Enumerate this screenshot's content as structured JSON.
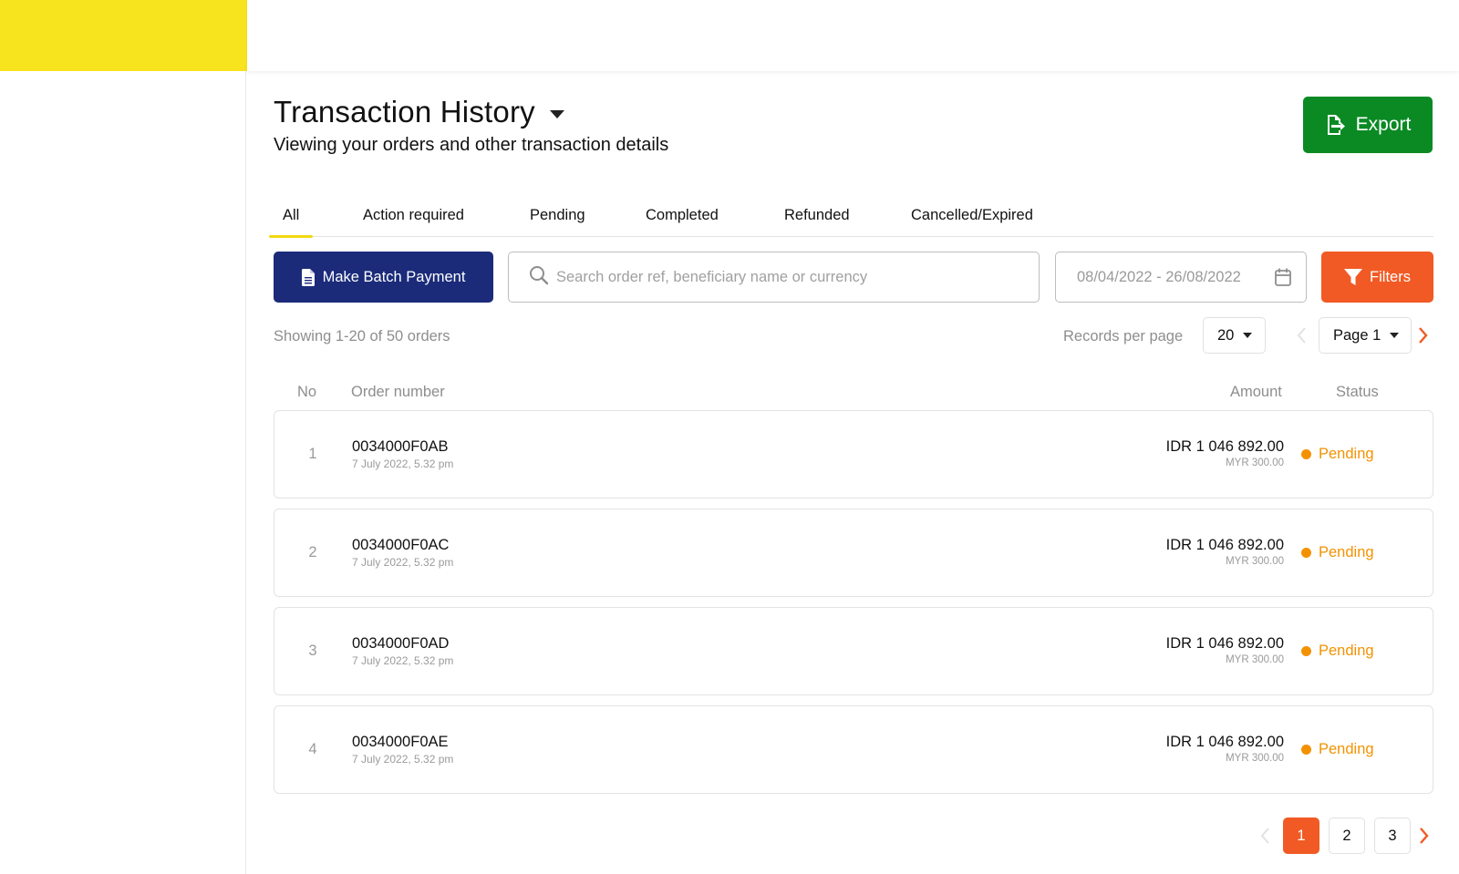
{
  "header": {
    "title": "Transaction History",
    "subtitle": "Viewing your orders and other transaction details",
    "export_label": "Export"
  },
  "tabs": [
    {
      "label": "All",
      "active": true
    },
    {
      "label": "Action required",
      "active": false
    },
    {
      "label": "Pending",
      "active": false
    },
    {
      "label": "Completed",
      "active": false
    },
    {
      "label": "Refunded",
      "active": false
    },
    {
      "label": "Cancelled/Expired",
      "active": false
    }
  ],
  "toolbar": {
    "batch_payment_label": "Make Batch Payment",
    "search_placeholder": "Search order ref, beneficiary name or currency",
    "date_range": "08/04/2022 - 26/08/2022",
    "filters_label": "Filters"
  },
  "listing": {
    "showing_text": "Showing 1-20 of 50 orders",
    "records_per_page_label": "Records per page",
    "records_per_page_value": "20",
    "page_select_value": "Page 1"
  },
  "table": {
    "headers": {
      "no": "No",
      "order_number": "Order number",
      "amount": "Amount",
      "status": "Status"
    },
    "rows": [
      {
        "no": "1",
        "order_number": "0034000F0AB",
        "date": "7 July 2022, 5.32 pm",
        "amount": "IDR 1 046 892.00",
        "amount_secondary": "MYR 300.00",
        "status": "Pending"
      },
      {
        "no": "2",
        "order_number": "0034000F0AC",
        "date": "7 July 2022, 5.32 pm",
        "amount": "IDR 1 046 892.00",
        "amount_secondary": "MYR 300.00",
        "status": "Pending"
      },
      {
        "no": "3",
        "order_number": "0034000F0AD",
        "date": "7 July 2022, 5.32 pm",
        "amount": "IDR 1 046 892.00",
        "amount_secondary": "MYR 300.00",
        "status": "Pending"
      },
      {
        "no": "4",
        "order_number": "0034000F0AE",
        "date": "7 July 2022, 5.32 pm",
        "amount": "IDR 1 046 892.00",
        "amount_secondary": "MYR 300.00",
        "status": "Pending"
      }
    ]
  },
  "pagination": {
    "pages": [
      "1",
      "2",
      "3"
    ],
    "current": "1"
  },
  "colors": {
    "brand_yellow": "#f7e31e",
    "export_green": "#0b8a24",
    "batch_navy": "#1b2b7a",
    "accent_orange": "#f15a24",
    "pending_orange": "#f39200"
  },
  "icons": {
    "export": "file-export-icon",
    "batch": "document-icon",
    "search": "search-icon",
    "calendar": "calendar-icon",
    "filters": "funnel-icon",
    "prev": "chevron-left-icon",
    "next": "chevron-right-icon"
  }
}
